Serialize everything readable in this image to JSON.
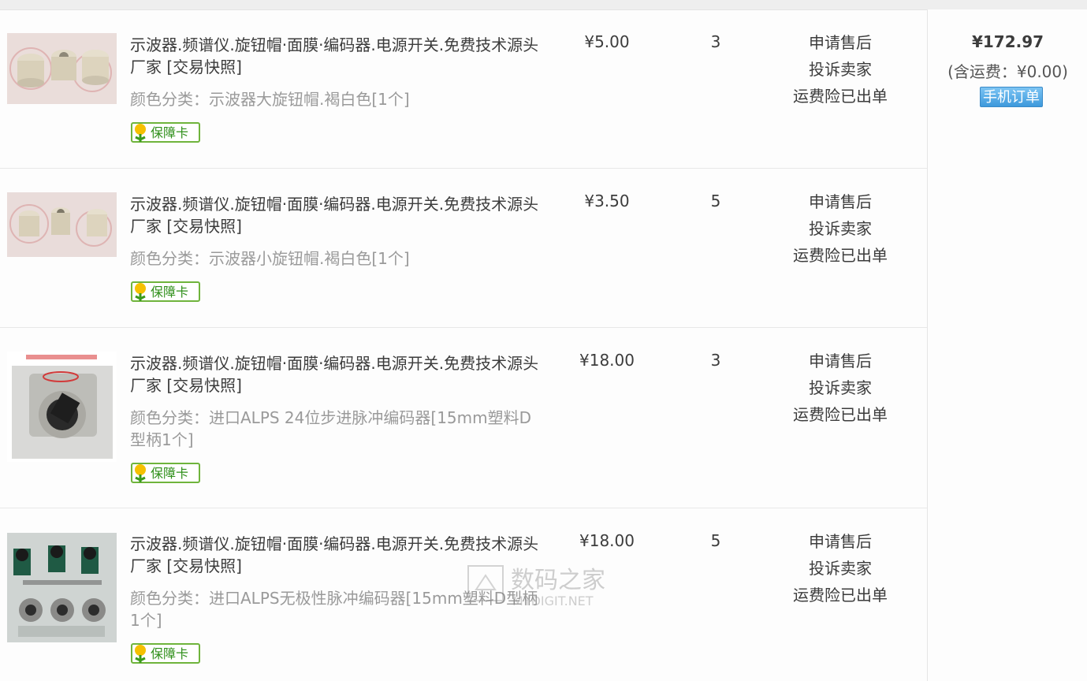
{
  "order": {
    "total": "¥172.97",
    "shipping_note": "(含运费：¥0.00)",
    "mobile_order_label": "手机订单"
  },
  "items": [
    {
      "title": "示波器.频谱仪.旋钮帽·面膜·编码器.电源开关.免费技术源头厂家",
      "snapshot": "[交易快照]",
      "sku": "颜色分类：示波器大旋钮帽.褐白色[1个]",
      "badge": "保障卡",
      "price": "¥5.00",
      "qty": "3",
      "actions": [
        "申请售后",
        "投诉卖家",
        "运费险已出单"
      ]
    },
    {
      "title": "示波器.频谱仪.旋钮帽·面膜·编码器.电源开关.免费技术源头厂家",
      "snapshot": "[交易快照]",
      "sku": "颜色分类：示波器小旋钮帽.褐白色[1个]",
      "badge": "保障卡",
      "price": "¥3.50",
      "qty": "5",
      "actions": [
        "申请售后",
        "投诉卖家",
        "运费险已出单"
      ]
    },
    {
      "title": "示波器.频谱仪.旋钮帽·面膜·编码器.电源开关.免费技术源头厂家",
      "snapshot": "[交易快照]",
      "sku": "颜色分类：进口ALPS 24位步进脉冲编码器[15mm塑料D型柄1个]",
      "badge": "保障卡",
      "price": "¥18.00",
      "qty": "3",
      "actions": [
        "申请售后",
        "投诉卖家",
        "运费险已出单"
      ]
    },
    {
      "title": "示波器.频谱仪.旋钮帽·面膜·编码器.电源开关.免费技术源头厂家",
      "snapshot": "[交易快照]",
      "sku": "颜色分类：进口ALPS无极性脉冲编码器[15mm塑料D型柄1个]",
      "badge": "保障卡",
      "price": "¥18.00",
      "qty": "5",
      "actions": [
        "申请售后",
        "投诉卖家",
        "运费险已出单"
      ]
    }
  ],
  "watermark": {
    "cn": "数码之家",
    "en": "MYDIGIT.NET"
  }
}
